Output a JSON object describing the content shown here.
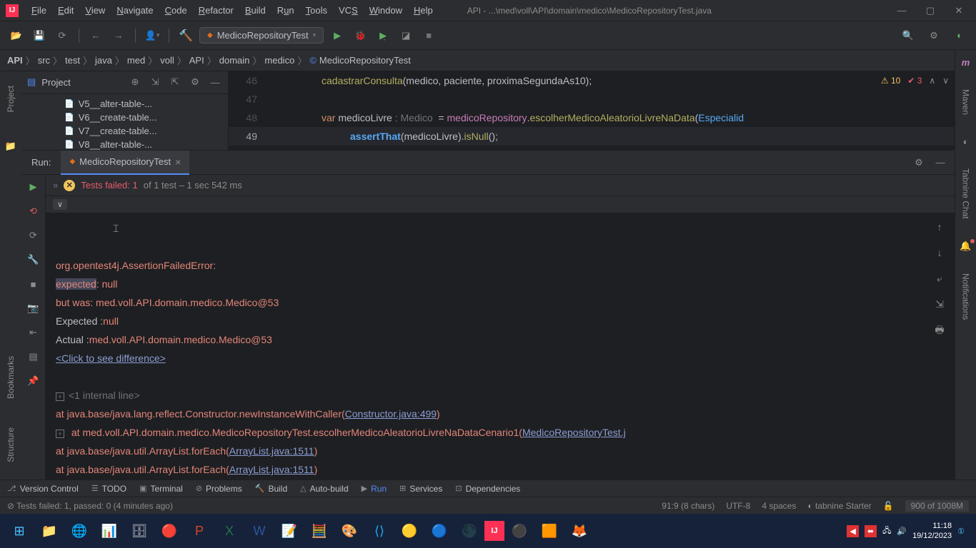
{
  "title_prefix": "API - ",
  "title_path": "...\\med\\voll\\API\\domain\\medico\\MedicoRepositoryTest.java",
  "menu": [
    "File",
    "Edit",
    "View",
    "Navigate",
    "Code",
    "Refactor",
    "Build",
    "Run",
    "Tools",
    "VCS",
    "Window",
    "Help"
  ],
  "menu_underline": [
    "F",
    "E",
    "V",
    "N",
    "C",
    "R",
    "B",
    "u",
    "T",
    "S",
    "W",
    "H"
  ],
  "run_config": "MedicoRepositoryTest",
  "breadcrumb": [
    "API",
    "src",
    "test",
    "java",
    "med",
    "voll",
    "API",
    "domain",
    "medico",
    "MedicoRepositoryTest"
  ],
  "project_label": "Project",
  "tree_items": [
    "V5__alter-table-...",
    "V6__create-table...",
    "V7__create-table...",
    "V8__alter-table-..."
  ],
  "gutter": [
    "46",
    "47",
    "48",
    "49"
  ],
  "code": {
    "l46_a": "cadastrarConsulta",
    "l46_b": "(medico, paciente, proximaSegundaAs10);",
    "l48_var": "var",
    "l48_name": " medicoLivre ",
    "l48_type": ": Medico",
    "l48_eq": "  = ",
    "l48_repo": "medicoRepository",
    "l48_dot": ".",
    "l48_method": "escolherMedicoAleatorioLivreNaData",
    "l48_open": "(",
    "l48_arg": "Especialid",
    "l49_assert": "assertThat",
    "l49_a": "(medicoLivre).",
    "l49_isnull": "isNull",
    "l49_b": "();"
  },
  "badges": {
    "warn": "10",
    "err": "3"
  },
  "run_panel": {
    "label": "Run:",
    "tab": "MedicoRepositoryTest",
    "status_fail": "Tests failed: 1",
    "status_rest": " of 1 test – 1 sec 542 ms"
  },
  "console": {
    "l1": "org.opentest4j.AssertionFailedError: ",
    "l2a": "expected",
    "l2b": ": null",
    "l3": " but was: med.voll.API.domain.medico.Medico@53",
    "l4a": "Expected :",
    "l4b": "null",
    "l5a": "Actual   :",
    "l5b": "med.voll.API.domain.medico.Medico@53",
    "l6": "<Click to see difference>",
    "l7": "<1 internal line>",
    "l8a": "   at java.base/java.lang.reflect.Constructor.newInstanceWithCaller(",
    "l8b": "Constructor.java:499",
    "l8c": ")",
    "l9a": "   at med.voll.API.domain.medico.MedicoRepositoryTest.escolherMedicoAleatorioLivreNaDataCenario1(",
    "l9b": "MedicoRepositoryTest.j",
    "l10a": "   at java.base/java.util.ArrayList.forEach(",
    "l10b": "ArrayList.java:1511",
    "l10c": ")",
    "l11a": "   at java.base/java.util.ArrayList.forEach(",
    "l11b": "ArrayList.java:1511",
    "l11c": ")"
  },
  "bottom": [
    "Version Control",
    "TODO",
    "Terminal",
    "Problems",
    "Build",
    "Auto-build",
    "Run",
    "Services",
    "Dependencies"
  ],
  "status": {
    "msg": "Tests failed: 1, passed: 0 (4 minutes ago)",
    "pos": "91:9 (8 chars)",
    "enc": "UTF-8",
    "indent": "4 spaces",
    "tabnine": "tabnine Starter",
    "mem": "900 of 1008M"
  },
  "right_rail": [
    "Maven",
    "Tabnine Chat",
    "Notifications"
  ],
  "left_rail": [
    "Project",
    "Bookmarks",
    "Structure"
  ],
  "clock": {
    "time": "11:18",
    "date": "19/12/2023"
  }
}
